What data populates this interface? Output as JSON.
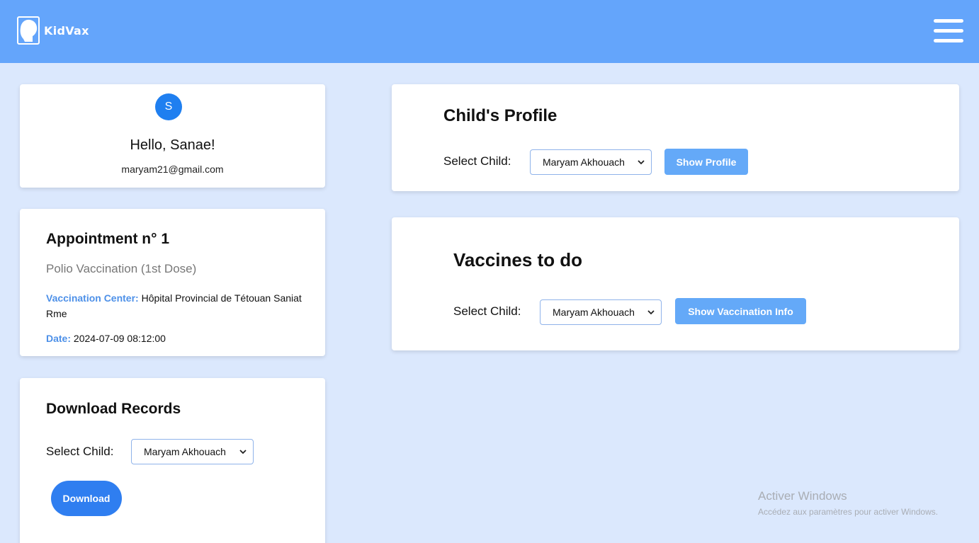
{
  "header": {
    "app_name": "KidVax",
    "menu_icon": "hamburger-menu-icon",
    "logo_icon": "child-head-icon",
    "color": "#64a5fb"
  },
  "user_card": {
    "avatar_initial": "S",
    "greeting": "Hello, Sanae!",
    "email": "maryam21@gmail.com"
  },
  "appointment": {
    "title": "Appointment n° 1",
    "vaccine": "Polio Vaccination (1st Dose)",
    "center_label": "Vaccination Center:",
    "center_value": "Hôpital Provincial de Tétouan Saniat Rme",
    "date_label": "Date:",
    "date_value": "2024-07-09 08:12:00"
  },
  "download": {
    "title": "Download Records",
    "select_label": "Select Child:",
    "selected_child": "Maryam Akhouach",
    "button_label": "Download"
  },
  "profile": {
    "title": "Child's Profile",
    "select_label": "Select Child:",
    "selected_child": "Maryam Akhouach",
    "button_label": "Show Profile"
  },
  "vaccines": {
    "title": "Vaccines to do",
    "select_label": "Select Child:",
    "selected_child": "Maryam Akhouach",
    "button_label": "Show Vaccination Info"
  },
  "watermark": {
    "line1": "Activer Windows",
    "line2": "Accédez aux paramètres pour activer Windows."
  },
  "colors": {
    "background": "#dbe8fd",
    "accent": "#2f7ef0",
    "label_blue": "#4d90e8"
  }
}
